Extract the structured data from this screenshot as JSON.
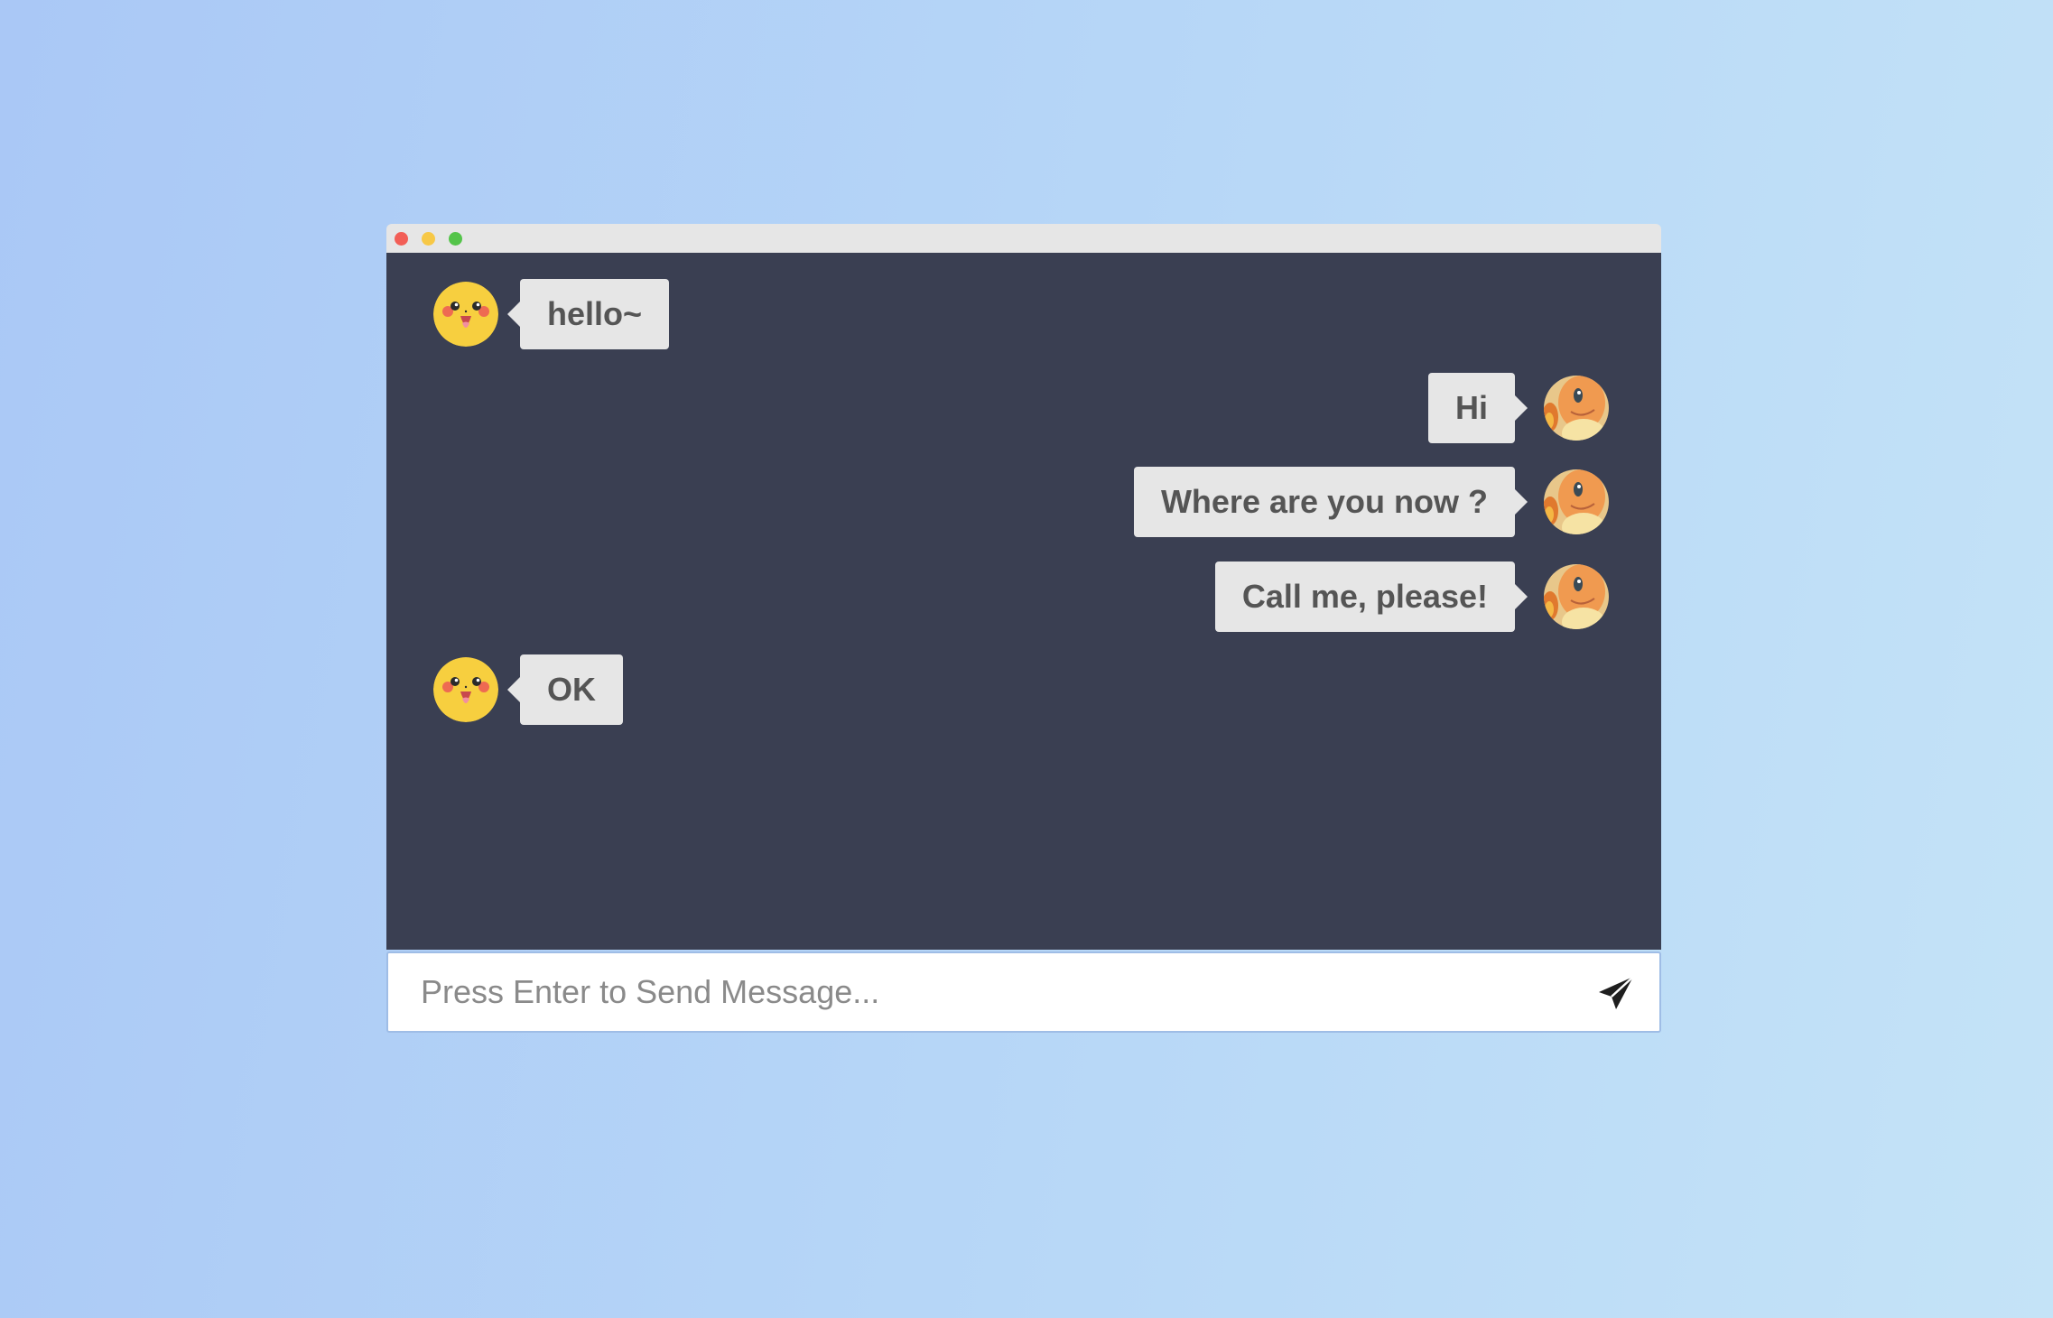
{
  "window": {
    "controls": [
      "close",
      "minimize",
      "maximize"
    ]
  },
  "chat": {
    "messages": [
      {
        "side": "left",
        "avatar": "pikachu-avatar",
        "text": "hello~"
      },
      {
        "side": "right",
        "avatar": "charmander-avatar",
        "text": "Hi"
      },
      {
        "side": "right",
        "avatar": "charmander-avatar",
        "text": "Where are you now ?"
      },
      {
        "side": "right",
        "avatar": "charmander-avatar",
        "text": "Call me, please!"
      },
      {
        "side": "left",
        "avatar": "pikachu-avatar",
        "text": "OK"
      }
    ]
  },
  "composer": {
    "placeholder": "Press Enter to Send Message...",
    "value": "",
    "send_icon": "paper-plane-icon"
  },
  "colors": {
    "background_start": "#aac8f6",
    "background_end": "#c4e3f7",
    "chat_background": "#3a3f52",
    "bubble": "#e6e6e6",
    "bubble_text": "#555555",
    "titlebar": "#e6e6e6",
    "close_dot": "#f25e56",
    "minimize_dot": "#f7c846",
    "maximize_dot": "#54c44a"
  }
}
